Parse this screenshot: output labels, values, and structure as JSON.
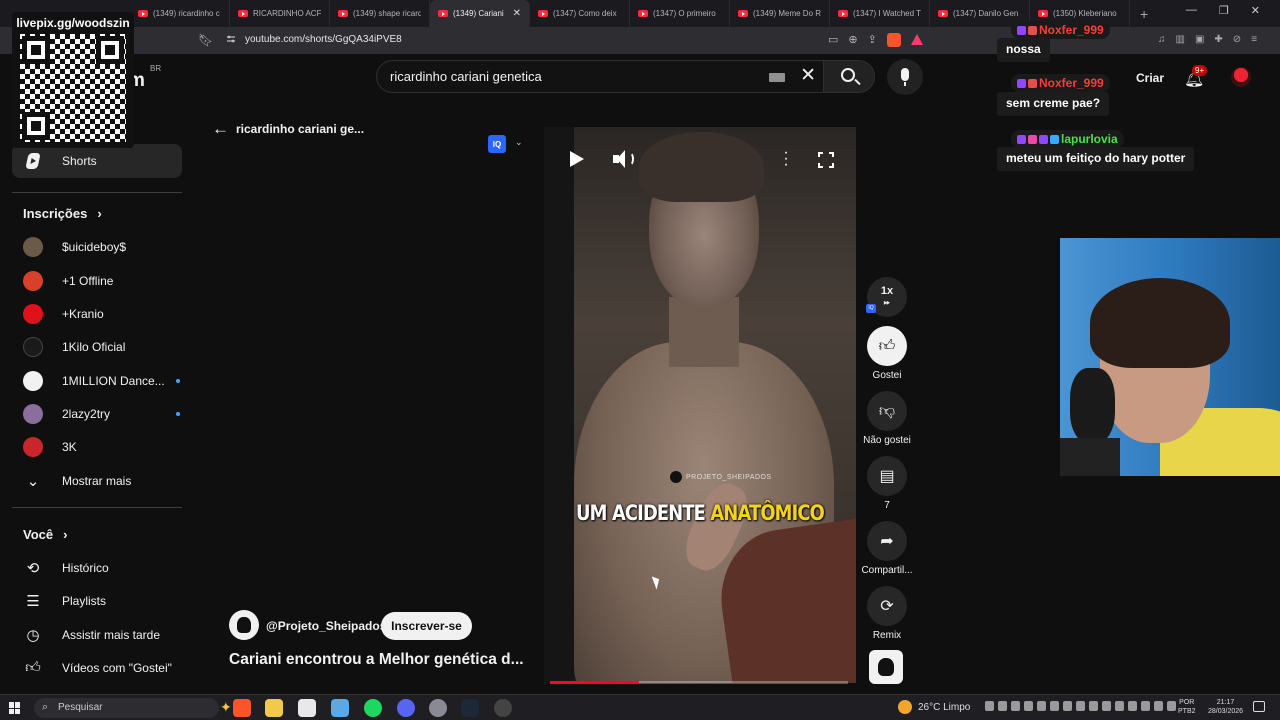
{
  "browser": {
    "tabs": [
      {
        "label": "(1349) ricardinho c",
        "active": false
      },
      {
        "label": "RICARDINHO ACF",
        "active": false
      },
      {
        "label": "(1349) shape ricard",
        "active": false
      },
      {
        "label": "(1349) Cariani",
        "active": true
      },
      {
        "label": "(1347) Como deix",
        "active": false
      },
      {
        "label": "(1347) O primeiro",
        "active": false
      },
      {
        "label": "(1349) Meme Do R",
        "active": false
      },
      {
        "label": "(1347) I Watched T",
        "active": false
      },
      {
        "label": "(1347) Danilo Gen",
        "active": false
      },
      {
        "label": "(1350) Kleberiano",
        "active": false
      }
    ],
    "new_tab": "+",
    "url": "youtube.com/shorts/GgQA34iPVE8"
  },
  "header": {
    "logo_suffix": "m",
    "region": "BR",
    "search_value": "ricardinho cariani genetica",
    "create_label": "Criar",
    "notification_count": "9+"
  },
  "sidebar": {
    "shorts_label": "Shorts",
    "subscriptions_heading": "Inscrições",
    "subscriptions": [
      {
        "label": "$uicideboy$",
        "new": false,
        "color": "#6b5a48"
      },
      {
        "label": "+1 Offline",
        "new": false,
        "color": "#d8402c"
      },
      {
        "label": "+Kranio",
        "new": false,
        "color": "#e0111b"
      },
      {
        "label": "1Kilo Oficial",
        "new": false,
        "color": "#1a1a1a"
      },
      {
        "label": "1MILLION Dance...",
        "new": true,
        "color": "#f1f1f1"
      },
      {
        "label": "2lazy2try",
        "new": true,
        "color": "#8a6f9e"
      },
      {
        "label": "3K",
        "new": false,
        "color": "#c9262c"
      }
    ],
    "show_more": "Mostrar mais",
    "you_heading": "Você",
    "you_items": [
      {
        "label": "Histórico",
        "icon": "history-icon"
      },
      {
        "label": "Playlists",
        "icon": "playlists-icon"
      },
      {
        "label": "Assistir mais tarde",
        "icon": "watch-later-icon"
      },
      {
        "label": "Vídeos com \"Gostei\"",
        "icon": "liked-videos-icon"
      }
    ]
  },
  "short": {
    "back_label": "ricardinho cariani ge...",
    "caption_word1": "UM ACIDENTE",
    "caption_word2": "ANATÔMICO",
    "watermark": "PROJETO_SHEIPADOS",
    "channel": "@Projeto_Sheipados",
    "subscribe": "Inscrever-se",
    "title": "Cariani encontrou a Melhor genética d...",
    "progress_fraction": 0.3,
    "iq_badge": "IQ"
  },
  "actions": {
    "speed": "1x",
    "like_label": "Gostei",
    "dislike_label": "Não gostei",
    "comments_count": "7",
    "share_label": "Compartil...",
    "remix_label": "Remix"
  },
  "overlay": {
    "qr_label": "livepix.gg/woodszin",
    "chat": [
      {
        "user": "Noxfer_999",
        "color": "#ff3b3b",
        "message": "nossa"
      },
      {
        "user": "Noxfer_999",
        "color": "#ff3b3b",
        "message": "sem creme pae?"
      },
      {
        "user": "lapurlovia",
        "color": "#4be04b",
        "message": "meteu um feitiço do hary potter"
      }
    ]
  },
  "taskbar": {
    "search_placeholder": "Pesquisar",
    "weather": "26°C  Limpo",
    "lang_top": "POR",
    "lang_bottom": "PTB2",
    "time": "21:17",
    "date": "28/03/2026"
  }
}
